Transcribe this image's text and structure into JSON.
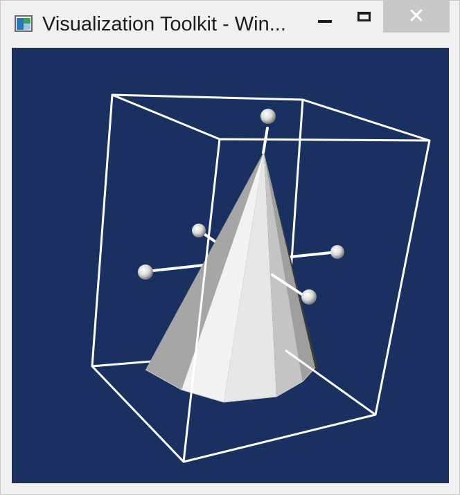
{
  "window": {
    "title": "Visualization Toolkit - Win...",
    "icon": "vtk-app-icon",
    "controls": {
      "minimize": {
        "icon": "minimize-icon"
      },
      "maximize": {
        "icon": "maximize-icon"
      },
      "close": {
        "icon": "close-icon",
        "glyph": "✕"
      }
    }
  },
  "viewport": {
    "background_color": "#1a3060",
    "bounding_box_color": "#ffffff",
    "cone_color": "#ffffff",
    "handles": [
      "top",
      "left",
      "right",
      "upper-left",
      "lower-right"
    ]
  }
}
